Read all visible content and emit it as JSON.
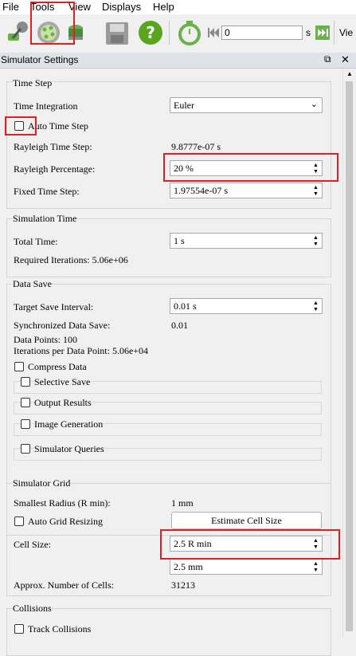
{
  "menu": [
    "File",
    "Tools",
    "View",
    "Displays",
    "Help"
  ],
  "toolbar": {
    "time_value": "0",
    "time_unit": "s",
    "view_label": "Vie"
  },
  "panel": {
    "title": "Simulator Settings"
  },
  "time_step": {
    "title": "Time Step",
    "integration_label": "Time Integration",
    "integration_value": "Euler",
    "auto_label": "Auto Time Step",
    "rayleigh_label": "Rayleigh Time Step:",
    "rayleigh_value": "9.8777e-07 s",
    "percent_label": "Rayleigh Percentage:",
    "percent_value": "20 %",
    "fixed_label": "Fixed Time Step:",
    "fixed_value": "1.97554e-07 s"
  },
  "sim_time": {
    "title": "Simulation Time",
    "total_label": "Total Time:",
    "total_value": "1 s",
    "iterations": "Required Iterations: 5.06e+06"
  },
  "data_save": {
    "title": "Data Save",
    "interval_label": "Target Save Interval:",
    "interval_value": "0.01 s",
    "sync_label": "Synchronized Data Save:",
    "sync_value": "0.01",
    "points": "Data Points: 100",
    "per_point": "Iterations per Data Point: 5.06e+04",
    "compress": "Compress Data",
    "selective": "Selective Save",
    "output": "Output Results",
    "image": "Image Generation",
    "queries": "Simulator Queries"
  },
  "grid": {
    "title": "Simulator Grid",
    "radius_label": "Smallest Radius (R min):",
    "radius_value": "1 mm",
    "auto_label": "Auto Grid Resizing",
    "estimate_btn": "Estimate Cell Size",
    "cell_label": "Cell Size:",
    "cell_value": "2.5 R min",
    "cell_mm": "2.5 mm",
    "cells_label": "Approx. Number of Cells:",
    "cells_value": "31213"
  },
  "collisions": {
    "title": "Collisions",
    "track": "Track Collisions"
  },
  "colors": {
    "highlight": "#e02020",
    "icon_green": "#6ab04c",
    "help_green": "#5aa520"
  }
}
